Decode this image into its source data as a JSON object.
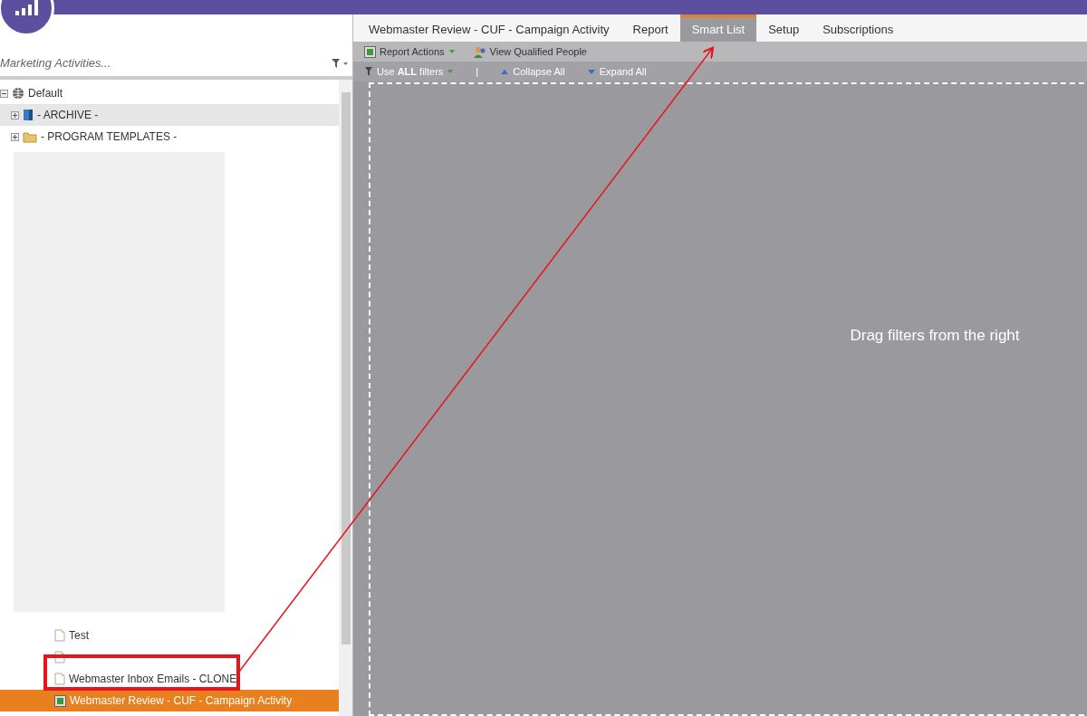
{
  "sidebar": {
    "search": {
      "placeholder": "Marketing Activities..."
    },
    "tree": [
      {
        "label": "Default",
        "kind": "globe",
        "expanded": true,
        "highlighted": false,
        "selected": false,
        "children": [
          {
            "label": "- ARCHIVE -",
            "kind": "archive",
            "expanded": false,
            "highlighted": true,
            "selected": false
          },
          {
            "label": "- PROGRAM TEMPLATES -",
            "kind": "folder",
            "expanded": false,
            "highlighted": false,
            "selected": false
          }
        ]
      }
    ],
    "tree_tail": [
      {
        "label": "Test",
        "kind": "list",
        "selected": false
      },
      {
        "kind": "list",
        "selected": false
      },
      {
        "label": "Webmaster Inbox Emails - CLONE",
        "kind": "list",
        "selected": false
      },
      {
        "label": "Webmaster Review - CUF - Campaign Activity",
        "kind": "report",
        "selected": true
      }
    ]
  },
  "tabs": [
    {
      "label": "Webmaster Review - CUF - Campaign Activity",
      "selected": false
    },
    {
      "label": "Report",
      "selected": false
    },
    {
      "label": "Smart List",
      "selected": true
    },
    {
      "label": "Setup",
      "selected": false
    },
    {
      "label": "Subscriptions",
      "selected": false
    }
  ],
  "toolbar": [
    {
      "label": "Report Actions",
      "kind": "report",
      "dropdown": true
    },
    {
      "label": "View Qualified People",
      "kind": "people",
      "dropdown": false
    }
  ],
  "filter_bar": {
    "use_filters": "Use **ALL** filters",
    "separator": "|",
    "collapse": "Collapse All",
    "expand": "Expand All"
  },
  "canvas": {
    "hint": "Drag filters from the right"
  }
}
